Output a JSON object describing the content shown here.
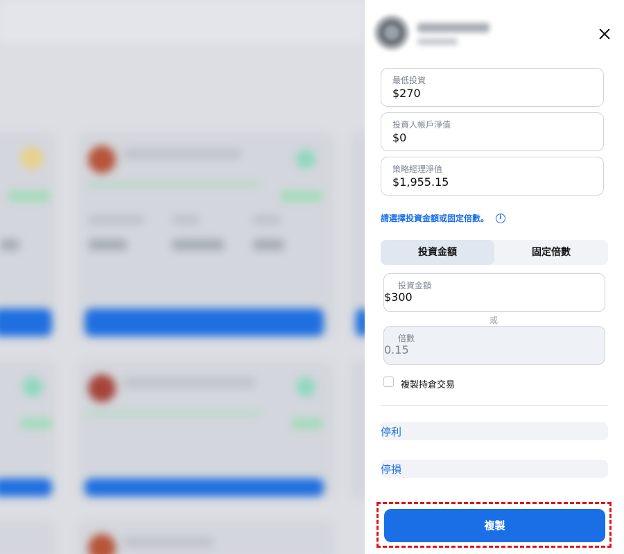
{
  "panel": {
    "fields": {
      "min_investment": {
        "label": "最低投資",
        "value": "$270"
      },
      "investor_equity": {
        "label": "投資人帳戶淨值",
        "value": "$0"
      },
      "manager_equity": {
        "label": "策略經理淨值",
        "value": "$1,955.15"
      }
    },
    "hint": "請選擇投資金額或固定倍數。",
    "mode_tabs": {
      "amount": "投資金額",
      "multiplier": "固定倍數",
      "selected": "投資金額"
    },
    "amount_input": {
      "label": "投資金額",
      "value": "$300"
    },
    "or_text": "或",
    "multiplier_input": {
      "label": "倍數",
      "value": "0.15"
    },
    "copy_positions_label": "複製持倉交易",
    "copy_positions_checked": false,
    "take_profit_label": "停利",
    "stop_loss_label": "停損",
    "copy_button_label": "複製"
  },
  "colors": {
    "accent": "#1a6fe6",
    "highlight": "#e0141a"
  },
  "icons": [
    "close-icon",
    "info-icon"
  ]
}
